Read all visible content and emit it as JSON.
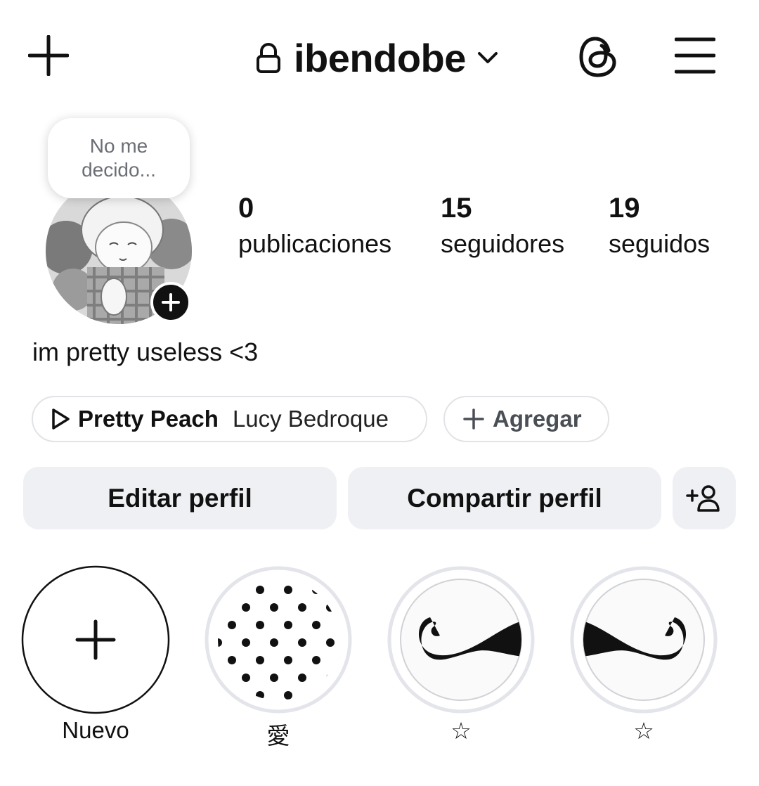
{
  "header": {
    "username": "ibendobe"
  },
  "note": {
    "text": "No me decido..."
  },
  "stats": [
    {
      "value": "0",
      "label": "publicaciones"
    },
    {
      "value": "15",
      "label": "seguidores"
    },
    {
      "value": "19",
      "label": "seguidos"
    }
  ],
  "bio": "im pretty useless <3",
  "music": {
    "title": "Pretty Peach",
    "artist": "Lucy Bedroque"
  },
  "add_chip": {
    "label": "Agregar"
  },
  "buttons": {
    "edit": "Editar perfil",
    "share": "Compartir perfil"
  },
  "highlights": [
    {
      "label": "Nuevo",
      "icon": "plus-icon"
    },
    {
      "label": "愛",
      "icon": "polka-dots"
    },
    {
      "label": "☆",
      "icon": "mustache"
    },
    {
      "label": "☆",
      "icon": "mustache"
    }
  ],
  "colors": {
    "text": "#111111",
    "secondary_text": "#6b6f75",
    "button_bg": "#eff0f3",
    "chip_border": "#e1e3e6",
    "highlight_ring": "#e3e5ea"
  }
}
